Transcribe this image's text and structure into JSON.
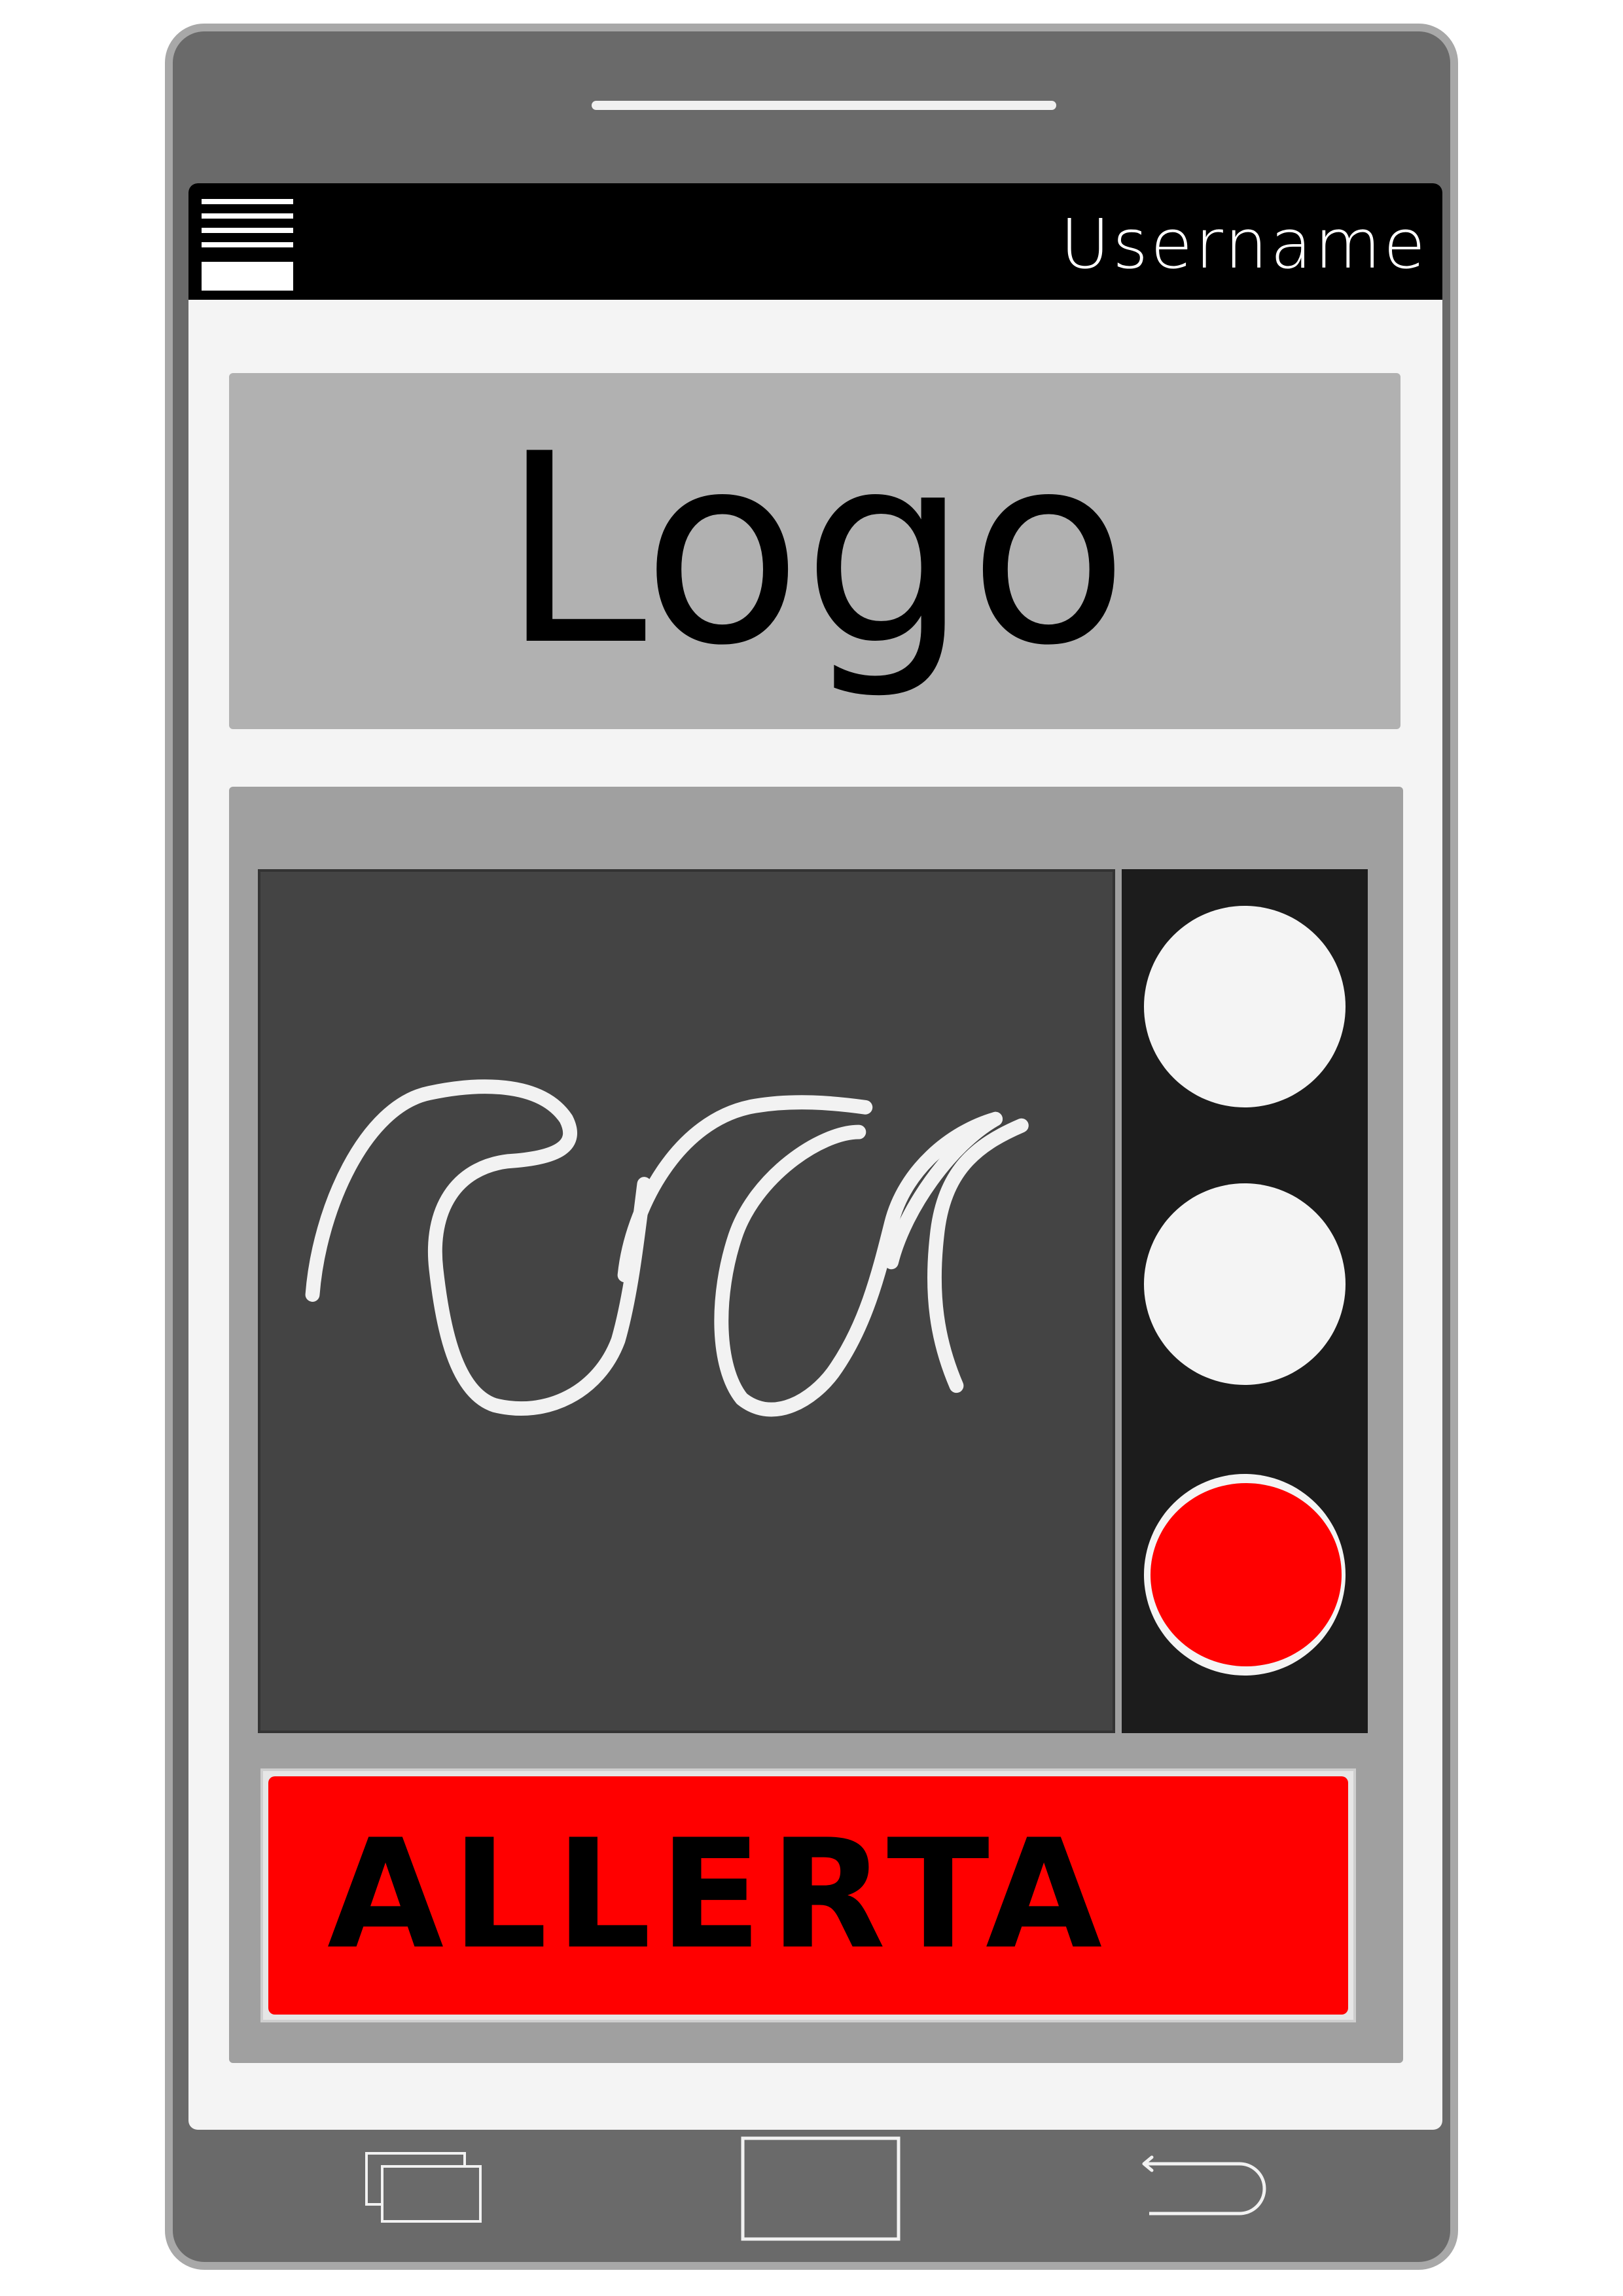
{
  "topbar": {
    "username": "Username",
    "menu_icon": "hamburger-menu-icon"
  },
  "logo": {
    "text": "Logo"
  },
  "main": {
    "display_content": "handwritten scribble placeholder",
    "buttons": [
      {
        "name": "option-1",
        "color": "#f4f4f4"
      },
      {
        "name": "option-2",
        "color": "#f4f4f4"
      },
      {
        "name": "option-3",
        "color": "#ff0000",
        "active": true
      }
    ],
    "alert_label": "ALLERTA"
  },
  "navbar": {
    "recent_icon": "recent-apps-icon",
    "home_icon": "home-icon",
    "back_icon": "back-arrow-icon"
  },
  "colors": {
    "accent": "#ff0000",
    "topbar": "#000000",
    "frame": "#6a6a6a"
  }
}
